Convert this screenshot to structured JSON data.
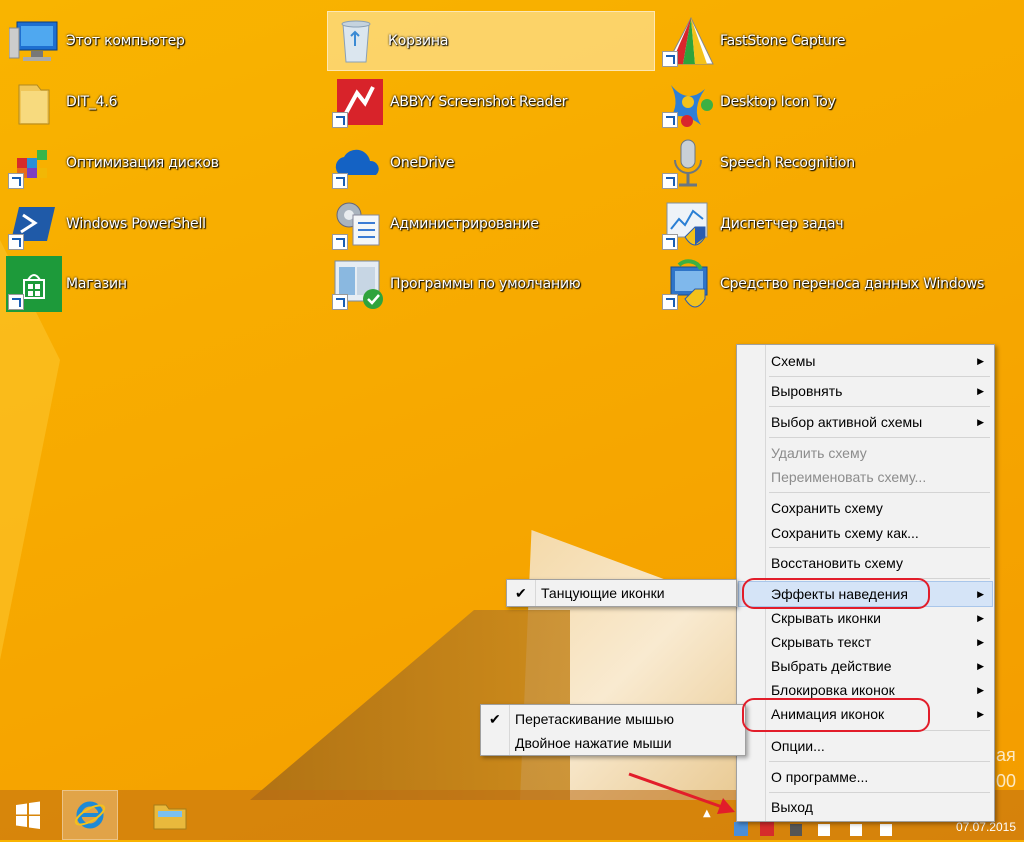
{
  "desktop": {
    "icons": [
      {
        "label": "Этот компьютер",
        "icon": "computer-icon"
      },
      {
        "label": "DIT_4.6",
        "icon": "folder-icon"
      },
      {
        "label": "Оптимизация дисков",
        "icon": "defrag-icon"
      },
      {
        "label": "Windows PowerShell",
        "icon": "powershell-icon"
      },
      {
        "label": "Магазин",
        "icon": "store-icon"
      },
      {
        "label": "Корзина",
        "icon": "recycle-bin-icon"
      },
      {
        "label": "ABBYY Screenshot Reader",
        "icon": "abbyy-icon"
      },
      {
        "label": "OneDrive",
        "icon": "onedrive-icon"
      },
      {
        "label": "Администрирование",
        "icon": "admin-tools-icon"
      },
      {
        "label": "Программы по умолчанию",
        "icon": "default-programs-icon"
      },
      {
        "label": "FastStone Capture",
        "icon": "faststone-icon"
      },
      {
        "label": "Desktop Icon Toy",
        "icon": "desktop-icon-toy-icon"
      },
      {
        "label": "Speech Recognition",
        "icon": "microphone-icon"
      },
      {
        "label": "Диспетчер задач",
        "icon": "task-manager-icon"
      },
      {
        "label": "Средство переноса данных Windows",
        "icon": "easy-transfer-icon"
      }
    ]
  },
  "context_menu": {
    "items": [
      {
        "label": "Схемы",
        "submenu": true
      },
      {
        "label": "Выровнять",
        "submenu": true
      },
      {
        "label": "Выбор активной схемы",
        "submenu": true
      },
      {
        "label": "Удалить схему",
        "disabled": true
      },
      {
        "label": "Переименовать схему...",
        "disabled": true
      },
      {
        "label": "Сохранить схему"
      },
      {
        "label": "Сохранить схему как..."
      },
      {
        "label": "Восстановить схему"
      },
      {
        "label": "Эффекты наведения",
        "submenu": true,
        "highlighted": true
      },
      {
        "label": "Скрывать иконки",
        "submenu": true
      },
      {
        "label": "Скрывать текст",
        "submenu": true
      },
      {
        "label": "Выбрать действие",
        "submenu": true
      },
      {
        "label": "Блокировка иконок",
        "submenu": true
      },
      {
        "label": "Анимация иконок",
        "submenu": true
      },
      {
        "label": "Опции..."
      },
      {
        "label": "О программе..."
      },
      {
        "label": "Выход"
      }
    ]
  },
  "hover_submenu": {
    "items": [
      {
        "label": "Танцующие иконки",
        "checked": true
      }
    ]
  },
  "animation_submenu": {
    "items": [
      {
        "label": "Перетаскивание мышью",
        "checked": true
      },
      {
        "label": "Двойное нажатие мыши",
        "checked": false
      }
    ]
  },
  "taskbar": {
    "date": "07.07.2015",
    "watermark_lines": [
      "ая",
      "00"
    ],
    "colors": {
      "accent": "#e21d2a",
      "menu_bg": "#f2f2f2",
      "hover": "#d5e4f7"
    }
  }
}
